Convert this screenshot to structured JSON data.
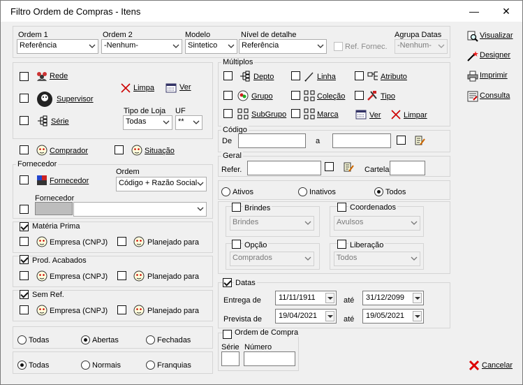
{
  "window": {
    "title": "Filtro Ordem de Compras - Itens",
    "minimize": "—",
    "close": "✕"
  },
  "top": {
    "ordem1": {
      "label": "Ordem 1",
      "value": "Referência"
    },
    "ordem2": {
      "label": "Ordem 2",
      "value": "-Nenhum-"
    },
    "modelo": {
      "label": "Modelo",
      "value": "Sintetico"
    },
    "nivel": {
      "label": "Nível de detalhe",
      "value": "Referência"
    },
    "ref_fornec": "Ref. Fornec.",
    "agrupa": {
      "label": "Agrupa Datas",
      "value": "-Nenhum-"
    }
  },
  "left1": {
    "rede": "Rede",
    "supervisor": "Supervisor",
    "serie": "Série",
    "limpa": "Limpa",
    "ver": "Ver",
    "tipo_loja": {
      "label": "Tipo de Loja",
      "value": "Todas"
    },
    "uf": {
      "label": "UF",
      "value": "**"
    }
  },
  "left2": {
    "comprador": "Comprador",
    "situacao": "Situação"
  },
  "fornecedor": {
    "group": "Fornecedor",
    "fornecedor": "Fornecedor",
    "ordem": {
      "label": "Ordem",
      "value": "Código + Razão Social"
    },
    "fornecedor2": "Fornecedor"
  },
  "materia": {
    "title": "Matéria Prima",
    "empresa": "Empresa (CNPJ)",
    "planejado": "Planejado para"
  },
  "prod": {
    "title": "Prod. Acabados",
    "empresa": "Empresa (CNPJ)",
    "planejado": "Planejado para"
  },
  "semref": {
    "title": "Sem Ref.",
    "empresa": "Empresa (CNPJ)",
    "planejado": "Planejado para"
  },
  "radios1": {
    "todas": "Todas",
    "abertas": "Abertas",
    "fechadas": "Fechadas"
  },
  "radios2": {
    "todas": "Todas",
    "normais": "Normais",
    "franquias": "Franquias"
  },
  "multiplos": {
    "title": "Múltiplos",
    "depto": "Depto",
    "linha": "Linha",
    "atributo": "Atributo",
    "grupo": "Grupo",
    "colecao": "Coleção",
    "tipo": "Tipo",
    "subgrupo": "SubGrupo",
    "marca": "Marca",
    "ver": "Ver",
    "limpar": "Limpar"
  },
  "codigo": {
    "title": "Código",
    "de": "De",
    "a": "a"
  },
  "geral": {
    "title": "Geral",
    "refer": "Refer.",
    "cartela": "Cartela"
  },
  "status": {
    "ativos": "Ativos",
    "inativos": "Inativos",
    "todos": "Todos"
  },
  "brindes": {
    "title": "Brindes",
    "value": "Brindes"
  },
  "coordenados": {
    "title": "Coordenados",
    "value": "Avulsos"
  },
  "opcao": {
    "title": "Opção",
    "value": "Comprados"
  },
  "liberacao": {
    "title": "Liberação",
    "value": "Todos"
  },
  "datas": {
    "title": "Datas",
    "entrega": "Entrega de",
    "prevista": "Prevista de",
    "ate": "até",
    "entrega_de": "11/11/1911",
    "entrega_ate": "31/12/2099",
    "prevista_de": "19/04/2021",
    "prevista_ate": "19/05/2021"
  },
  "ordem_compra": {
    "title": "Ordem de Compra",
    "serie": "Série",
    "numero": "Número"
  },
  "actions": {
    "visualizar": "Visualizar",
    "designer": "Designer",
    "imprimir": "Imprimir",
    "consulta": "Consulta",
    "cancelar": "Cancelar"
  }
}
